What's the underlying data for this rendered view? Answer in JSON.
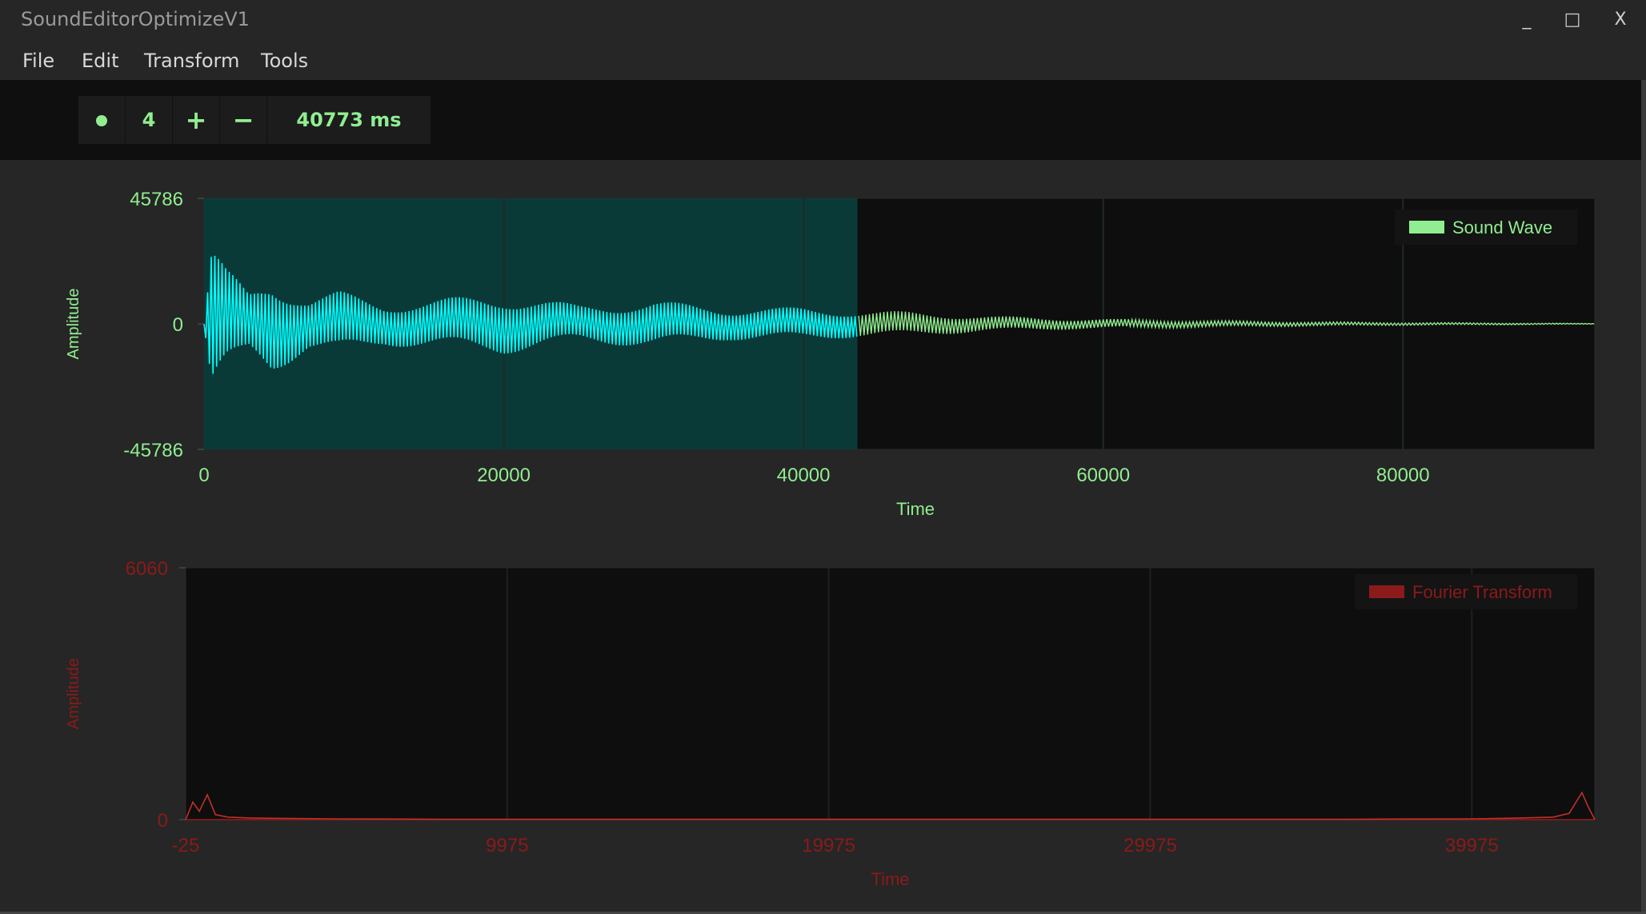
{
  "window": {
    "title": "SoundEditorOptimizeV1",
    "minimize_label": "_",
    "maximize_label": "□",
    "close_label": "X"
  },
  "menu": [
    {
      "label": "File"
    },
    {
      "label": "Edit"
    },
    {
      "label": "Transform"
    },
    {
      "label": "Tools"
    }
  ],
  "toolbar": {
    "record_icon": "record-dot-icon",
    "count_value": "4",
    "plus_label": "+",
    "minus_label": "−",
    "time_value": "40773 ms"
  },
  "colors": {
    "accent_green": "#90ee90",
    "wave_cyan": "#00ffff",
    "selection_fill": "#0a3a38",
    "fourier_red": "#8b1a1a",
    "plot_bg": "#0e0e0e",
    "window_bg": "#262626"
  },
  "chart_data": [
    {
      "type": "line",
      "xlabel": "Time",
      "ylabel": "Amplitude",
      "xlim": [
        0,
        92800
      ],
      "ylim": [
        -45786,
        45786
      ],
      "x_ticks": [
        "0",
        "20000",
        "40000",
        "60000",
        "80000"
      ],
      "y_ticks": [
        "45786",
        "0",
        "-45786"
      ],
      "legend": {
        "label": "Sound Wave",
        "position": "top-right"
      },
      "selection": {
        "start": 0,
        "end": 43600
      },
      "series": [
        {
          "name": "Sound Wave",
          "envelope": [
            [
              0,
              0
            ],
            [
              500,
              30000
            ],
            [
              1500,
              20000
            ],
            [
              3000,
              12000
            ],
            [
              4500,
              18000
            ],
            [
              7000,
              10000
            ],
            [
              9000,
              12000
            ],
            [
              12000,
              8000
            ],
            [
              15000,
              9000
            ],
            [
              20000,
              11000
            ],
            [
              25000,
              7000
            ],
            [
              30000,
              8500
            ],
            [
              35000,
              6000
            ],
            [
              40000,
              6000
            ],
            [
              43500,
              5000
            ],
            [
              47000,
              4500
            ],
            [
              52000,
              3000
            ],
            [
              58000,
              2000
            ],
            [
              63000,
              1600
            ],
            [
              70000,
              1000
            ],
            [
              78000,
              600
            ],
            [
              85000,
              400
            ],
            [
              92800,
              150
            ]
          ]
        }
      ]
    },
    {
      "type": "line",
      "xlabel": "Time",
      "ylabel": "Amplitude",
      "xlim": [
        -25,
        43800
      ],
      "ylim": [
        0,
        6060
      ],
      "x_ticks": [
        "-25",
        "9975",
        "19975",
        "29975",
        "39975"
      ],
      "y_ticks": [
        "6060",
        "0"
      ],
      "legend": {
        "label": "Fourier Transform",
        "position": "top-right"
      },
      "series": [
        {
          "name": "Fourier Transform",
          "points": [
            [
              -25,
              0
            ],
            [
              200,
              420
            ],
            [
              400,
              200
            ],
            [
              650,
              600
            ],
            [
              900,
              120
            ],
            [
              1300,
              60
            ],
            [
              2000,
              40
            ],
            [
              3000,
              30
            ],
            [
              4500,
              20
            ],
            [
              6000,
              15
            ],
            [
              8000,
              10
            ],
            [
              36000,
              10
            ],
            [
              38000,
              15
            ],
            [
              40000,
              20
            ],
            [
              41500,
              40
            ],
            [
              42500,
              60
            ],
            [
              43000,
              150
            ],
            [
              43400,
              650
            ],
            [
              43600,
              300
            ],
            [
              43800,
              0
            ]
          ]
        }
      ]
    }
  ]
}
